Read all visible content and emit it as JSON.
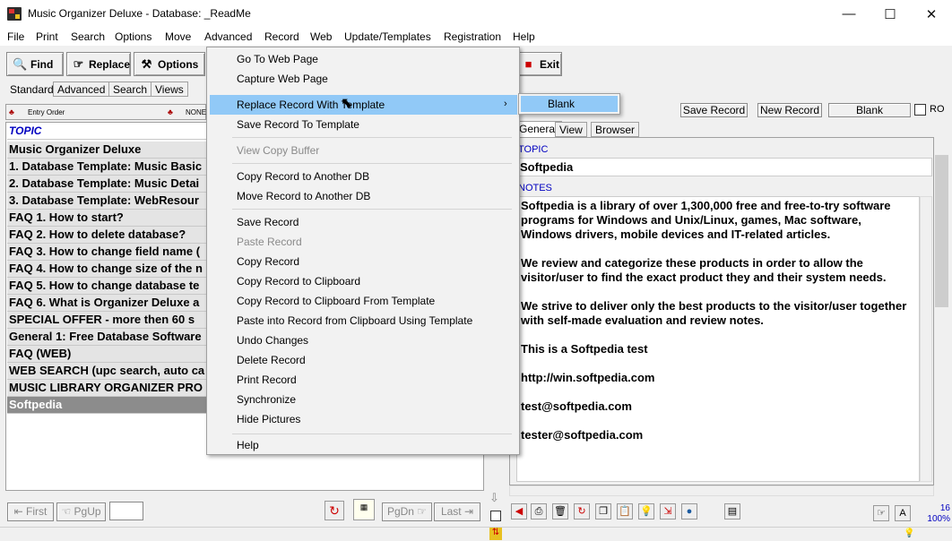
{
  "window": {
    "title": "Music Organizer Deluxe - Database: _ReadMe",
    "min_glyph": "—",
    "max_glyph": "☐",
    "close_glyph": "✕"
  },
  "menubar": [
    "File",
    "Print",
    "Search",
    "Options",
    "Move",
    "Advanced",
    "Record",
    "Web",
    "Update/Templates",
    "Registration",
    "Help"
  ],
  "toolbar": {
    "find": "Find",
    "replace": "Replace",
    "options": "Options",
    "exit": "Exit"
  },
  "left_tabs": [
    "Standard",
    "Advanced",
    "Search",
    "Views"
  ],
  "sort": {
    "entry_order": "Entry Order",
    "none": "NONE"
  },
  "list": {
    "header": "TOPIC",
    "rows": [
      "Music Organizer Deluxe",
      "1. Database Template: Music Basic",
      "2. Database Template: Music Detai",
      "3. Database Template: WebResour",
      "FAQ 1. How to start?",
      "FAQ 2. How to delete database?",
      "FAQ 3. How to change field name (",
      "FAQ 4. How to change size of the n",
      "FAQ 5. How to change database te",
      "FAQ 6. What is Organizer Deluxe a",
      "SPECIAL OFFER - more then 60 s",
      "General 1: Free Database Software",
      "FAQ (WEB)",
      "WEB SEARCH (upc search, auto ca",
      "MUSIC LIBRARY ORGANIZER PRO",
      "Softpedia"
    ],
    "selected_index": 15
  },
  "nav": {
    "first": "First",
    "pgup": "PgUp",
    "pgdn": "PgDn",
    "last": "Last"
  },
  "menu": {
    "items": [
      {
        "label": "Go To Web Page",
        "disabled": false
      },
      {
        "label": "Capture Web Page",
        "disabled": false
      },
      {
        "label": "Replace Record With Template",
        "disabled": false,
        "submenu": true
      },
      {
        "label": "Save Record To Template",
        "disabled": false
      },
      {
        "label": "View Copy Buffer",
        "disabled": true
      },
      {
        "label": "Copy Record to Another DB",
        "disabled": false
      },
      {
        "label": "Move Record to Another DB",
        "disabled": false
      },
      {
        "label": "Save Record",
        "disabled": false
      },
      {
        "label": "Paste Record",
        "disabled": true
      },
      {
        "label": "Copy Record",
        "disabled": false
      },
      {
        "label": "Copy Record to Clipboard",
        "disabled": false
      },
      {
        "label": "Copy Record to Clipboard From Template",
        "disabled": false
      },
      {
        "label": "Paste into Record from Clipboard Using Template",
        "disabled": false
      },
      {
        "label": "Undo Changes",
        "disabled": false
      },
      {
        "label": "Delete Record",
        "disabled": false
      },
      {
        "label": "Print Record",
        "disabled": false
      },
      {
        "label": "Synchronize",
        "disabled": false
      },
      {
        "label": "Hide Pictures",
        "disabled": false
      },
      {
        "label": "Help",
        "disabled": false
      }
    ],
    "submenu_item": "Blank"
  },
  "right": {
    "save_record": "Save Record",
    "new_record": "New Record",
    "blank": "Blank",
    "ro": "RO",
    "tabs": [
      "General",
      "View",
      "Browser"
    ],
    "topic_label": "TOPIC",
    "topic_value": "Softpedia",
    "notes_label": "NOTES",
    "notes": [
      "Softpedia is a library of over 1,300,000 free and free-to-try software",
      "programs for Windows and Unix/Linux, games, Mac software,",
      "Windows drivers, mobile devices and IT-related articles.",
      "",
      "We review and categorize these products in order to allow the",
      "visitor/user to find the exact product they and their system needs.",
      "",
      "We strive to deliver only the best products to the visitor/user together",
      "with self-made evaluation and review notes.",
      "",
      "This is a Softpedia test",
      "",
      "http://win.softpedia.com",
      "",
      "test@softpedia.com",
      "",
      "tester@softpedia.com"
    ],
    "counter": "16",
    "zoom": "100%"
  },
  "colors": {
    "topic_header": "#0000c0",
    "menu_highlight": "#91c9f7",
    "selected_row": "#8c8c8c"
  }
}
